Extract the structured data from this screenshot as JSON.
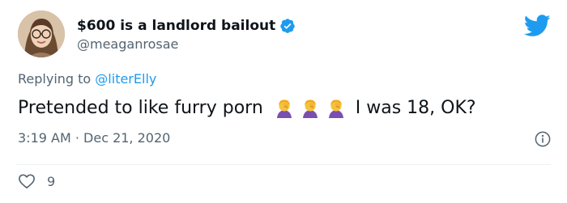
{
  "author": {
    "display_name": "$600 is a landlord bailout",
    "handle": "@meaganrosae",
    "verified": true
  },
  "reply": {
    "prefix": "Replying to",
    "target": "@literElly"
  },
  "tweet": {
    "text_before": "Pretended to like furry porn",
    "emojis": [
      "woman-facepalming",
      "woman-facepalming",
      "woman-facepalming"
    ],
    "text_after": "I was 18, OK?",
    "timestamp": "3:19 AM · Dec 21, 2020"
  },
  "engagement": {
    "likes": "9"
  },
  "icons": {
    "verified": "verified-badge-icon",
    "brand": "twitter-bird-icon",
    "info": "info-icon",
    "like": "heart-icon"
  },
  "colors": {
    "brand": "#1d9bf0",
    "muted": "#536471",
    "text": "#0f1419"
  }
}
